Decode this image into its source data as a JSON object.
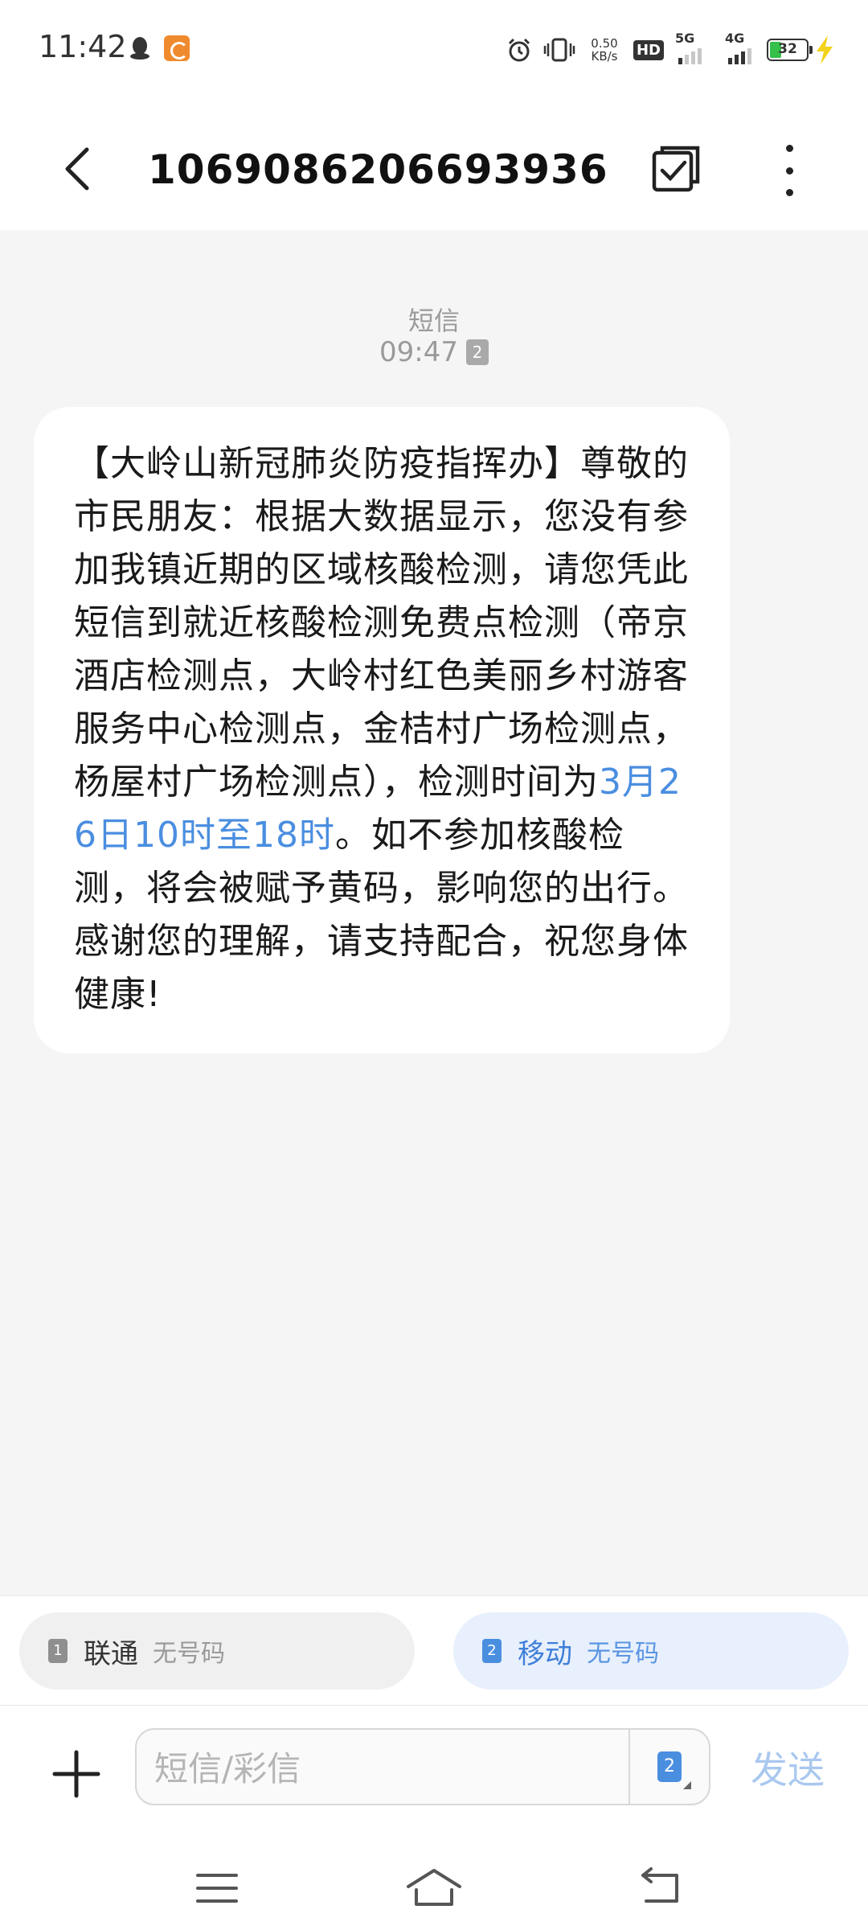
{
  "status_bar": {
    "time": "11:42",
    "net_speed_value": "0.50",
    "net_speed_unit": "KB/s",
    "hd_label": "HD",
    "sim1_net": "5G",
    "sim2_net": "4G",
    "battery": "32",
    "battery_fraction": 0.32
  },
  "header": {
    "title": "1069086206693936"
  },
  "conversation": {
    "message_type": "短信",
    "message_time": "09:47",
    "sim_badge": "2",
    "message_before_link": "【大岭山新冠肺炎防疫指挥办】尊敬的市民朋友：根据大数据显示，您没有参加我镇近期的区域核酸检测，请您凭此短信到就近核酸检测免费点检测（帝京酒店检测点，大岭村红色美丽乡村游客服务中心检测点，金桔村广场检测点，杨屋村广场检测点），检测时间为",
    "message_link": "3月26日10时至18时",
    "message_after_link": "。如不参加核酸检测，将会被赋予黄码，影响您的出行。感谢您的理解，请支持配合，祝您身体健康!"
  },
  "sim_selector": {
    "sim1_num": "1",
    "sim1_name": "联通",
    "sim1_number": "无号码",
    "sim2_num": "2",
    "sim2_name": "移动",
    "sim2_number": "无号码"
  },
  "compose": {
    "placeholder": "短信/彩信",
    "sim_indicator": "2",
    "send_label": "发送"
  },
  "icons": {
    "back": "back-arrow-icon",
    "edit": "edit-select-icon",
    "more": "more-vertical-icon",
    "plus": "plus-icon",
    "nav_menu": "menu-icon",
    "nav_home": "home-icon",
    "nav_back": "back-icon"
  },
  "colors": {
    "accent": "#4a8ee0",
    "background": "#f5f5f5",
    "bubble": "#ffffff",
    "send_disabled": "#a9c8ef",
    "battery_green": "#35c04a"
  }
}
